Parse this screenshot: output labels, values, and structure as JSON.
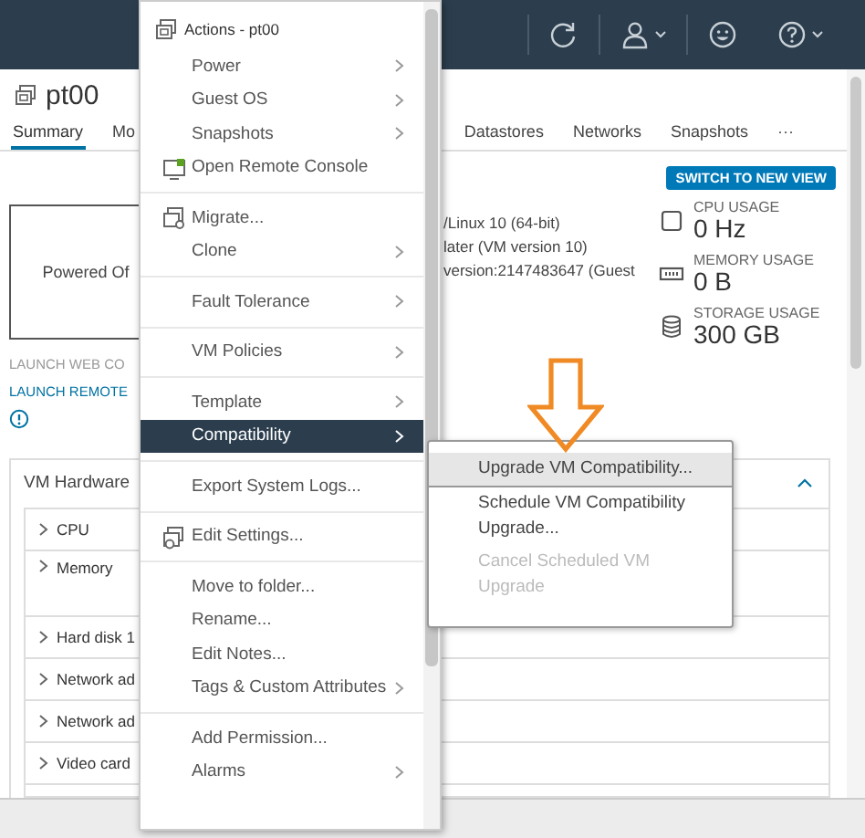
{
  "vm": {
    "name": "pt00"
  },
  "tabs": [
    {
      "label": "Summary",
      "selected": true
    },
    {
      "label": "Mo",
      "selected": false
    },
    {
      "label": "Datastores",
      "selected": false
    },
    {
      "label": "Networks",
      "selected": false
    },
    {
      "label": "Snapshots",
      "selected": false
    },
    {
      "label": "···",
      "selected": false
    }
  ],
  "console": {
    "status": "Powered Of",
    "launch_web": "LAUNCH WEB CO",
    "launch_remote": "LAUNCH REMOTE"
  },
  "details": [
    "/Linux 10 (64-bit)",
    "later (VM version 10)",
    "version:2147483647 (Guest"
  ],
  "switch_button": "SWITCH TO NEW VIEW",
  "usage": [
    {
      "kind": "cpu",
      "label": "CPU USAGE",
      "value": "0 Hz"
    },
    {
      "kind": "memory",
      "label": "MEMORY USAGE",
      "value": "0 B"
    },
    {
      "kind": "storage",
      "label": "STORAGE USAGE",
      "value": "300 GB"
    }
  ],
  "hardware": {
    "title": "VM Hardware",
    "expanded": true,
    "rows": [
      "CPU",
      "Memory",
      "Hard disk 1",
      "Network ad",
      "Network ad",
      "Video card"
    ]
  },
  "actions_menu": {
    "title": "Actions - pt00",
    "groups": [
      [
        {
          "label": "Power",
          "kind": "plain",
          "submenu": true,
          "selected": false
        },
        {
          "label": "Guest OS",
          "kind": "plain",
          "submenu": true,
          "selected": false
        },
        {
          "label": "Snapshots",
          "kind": "plain",
          "submenu": true,
          "selected": false
        },
        {
          "label": "Open Remote Console",
          "kind": "console",
          "submenu": false,
          "selected": false
        }
      ],
      [
        {
          "label": "Migrate...",
          "kind": "migrate",
          "submenu": false,
          "selected": false
        },
        {
          "label": "Clone",
          "kind": "plain",
          "submenu": true,
          "selected": false
        }
      ],
      [
        {
          "label": "Fault Tolerance",
          "kind": "plain",
          "submenu": true,
          "selected": false
        }
      ],
      [
        {
          "label": "VM Policies",
          "kind": "plain",
          "submenu": true,
          "selected": false
        }
      ],
      [
        {
          "label": "Template",
          "kind": "plain",
          "submenu": true,
          "selected": false
        },
        {
          "label": "Compatibility",
          "kind": "plain",
          "submenu": true,
          "selected": true
        }
      ],
      [
        {
          "label": "Export System Logs...",
          "kind": "plain",
          "submenu": false,
          "selected": false
        }
      ],
      [
        {
          "label": "Edit Settings...",
          "kind": "settings",
          "submenu": false,
          "selected": false
        }
      ],
      [
        {
          "label": "Move to folder...",
          "kind": "plain",
          "submenu": false,
          "selected": false
        },
        {
          "label": "Rename...",
          "kind": "plain",
          "submenu": false,
          "selected": false
        },
        {
          "label": "Edit Notes...",
          "kind": "plain",
          "submenu": false,
          "selected": false
        },
        {
          "label": "Tags & Custom Attributes",
          "kind": "plain",
          "submenu": true,
          "selected": false
        }
      ],
      [
        {
          "label": "Add Permission...",
          "kind": "plain",
          "submenu": false,
          "selected": false
        },
        {
          "label": "Alarms",
          "kind": "plain",
          "submenu": true,
          "selected": false
        }
      ]
    ]
  },
  "compatibility_submenu": [
    {
      "label": "Upgrade VM Compatibility...",
      "selected": true,
      "disabled": false
    },
    {
      "label": "Schedule VM Compatibility Upgrade...",
      "selected": false,
      "disabled": false
    },
    {
      "label": "Cancel Scheduled VM Upgrade",
      "selected": false,
      "disabled": true
    }
  ]
}
